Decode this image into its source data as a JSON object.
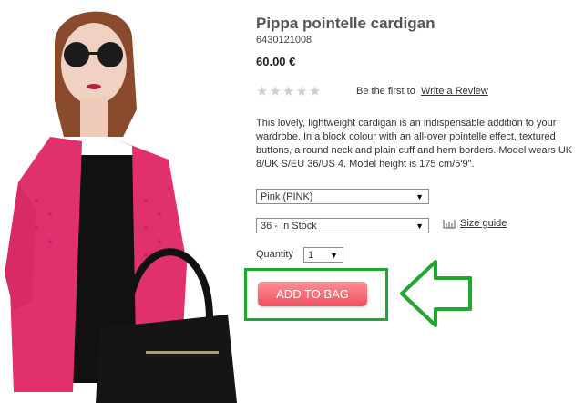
{
  "product": {
    "title": "Pippa pointelle cardigan",
    "sku": "6430121008",
    "price": "60.00 €",
    "rating": {
      "value": 0,
      "max": 5,
      "prompt": "Be the first to",
      "review_link": "Write a Review"
    },
    "description": "This lovely, lightweight cardigan is an indispensable addition to your wardrobe. In a block colour with an all-over pointelle effect, textured buttons, a round neck and plain cuff and hem borders. Model wears UK 8/UK S/EU 36/US 4. Model height is 175 cm/5'9\".",
    "color_select": {
      "value": "Pink (PINK)"
    },
    "size_select": {
      "value": "36 - In Stock"
    },
    "size_guide": "Size guide",
    "quantity": {
      "label": "Quantity",
      "value": "1"
    },
    "add_to_bag": "ADD TO BAG"
  },
  "colors": {
    "button": "#f0505f",
    "highlight": "#21a632",
    "cardigan": "#e0306e"
  },
  "icons": {
    "dropdown": "triangle-down-icon",
    "size_guide": "ruler-icon",
    "annotation": "arrow-left-icon"
  }
}
